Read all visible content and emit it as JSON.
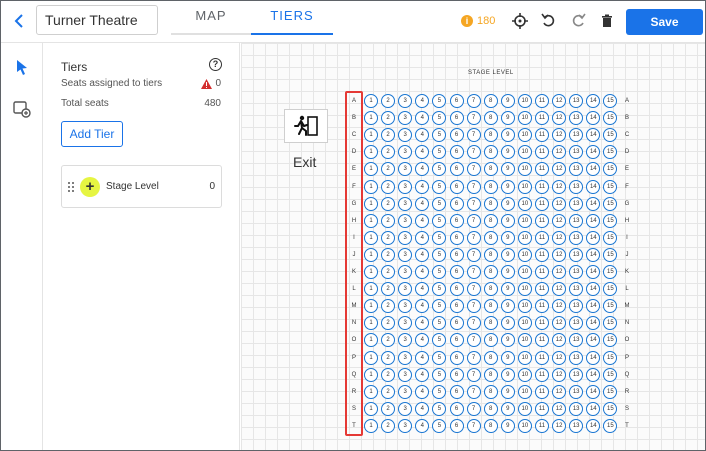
{
  "header": {
    "venue_name": "Turner Theatre",
    "tabs": [
      {
        "label": "MAP",
        "active": false
      },
      {
        "label": "TIERS",
        "active": true
      }
    ],
    "points": "180",
    "points_coin_glyph": "i",
    "save_label": "Save"
  },
  "panel": {
    "title": "Tiers",
    "help_glyph": "?",
    "seats_assigned_label": "Seats assigned to tiers",
    "seats_assigned_value": "0",
    "total_seats_label": "Total seats",
    "total_seats_value": "480",
    "add_tier_label": "Add Tier",
    "tiers": [
      {
        "name": "Stage Level",
        "count": "0",
        "color": "#e6f542",
        "glyph": "+"
      }
    ]
  },
  "canvas": {
    "stage_label": "STAGE LEVEL",
    "exit_label": "Exit",
    "rows": [
      "A",
      "B",
      "C",
      "D",
      "E",
      "F",
      "G",
      "H",
      "I",
      "J",
      "K",
      "L",
      "M",
      "N",
      "O",
      "P",
      "Q",
      "R",
      "S",
      "T"
    ],
    "seats_per_row": 15
  },
  "colors": {
    "accent": "#1a73e8",
    "seat_border": "#1976d2",
    "highlight": "#e53935",
    "warning": "#d32f2f",
    "points": "#f5a623"
  }
}
